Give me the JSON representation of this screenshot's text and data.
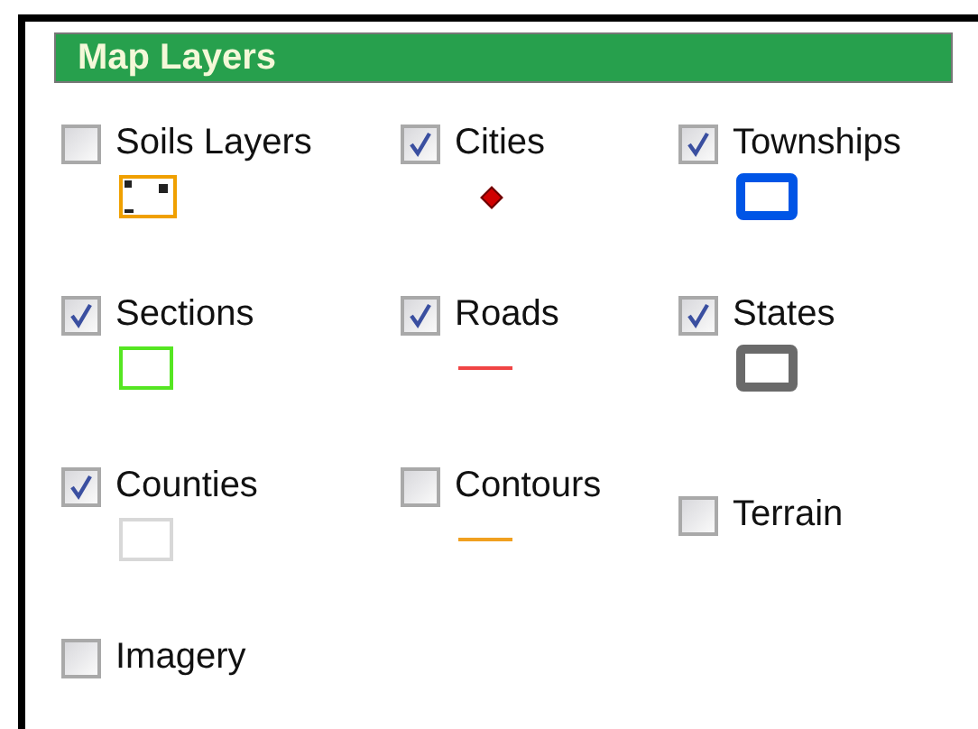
{
  "panel": {
    "title": "Map Layers"
  },
  "layers": [
    {
      "label": "Soils Layers",
      "checked": false,
      "legend": {
        "kind": "dashed-box",
        "color": "#f0a000"
      }
    },
    {
      "label": "Cities",
      "checked": true,
      "legend": {
        "kind": "dot",
        "color": "#d00000"
      }
    },
    {
      "label": "Townships",
      "checked": true,
      "legend": {
        "kind": "thick-box",
        "color": "#0055e6"
      }
    },
    {
      "label": "Sections",
      "checked": true,
      "legend": {
        "kind": "thin-box",
        "color": "#55e622"
      }
    },
    {
      "label": "Roads",
      "checked": true,
      "legend": {
        "kind": "line",
        "color": "#f04444"
      }
    },
    {
      "label": "States",
      "checked": true,
      "legend": {
        "kind": "thick-box",
        "color": "#6a6a6a"
      }
    },
    {
      "label": "Counties",
      "checked": true,
      "legend": {
        "kind": "thin-box",
        "color": "#d8d8d8"
      }
    },
    {
      "label": "Contours",
      "checked": false,
      "legend": {
        "kind": "line",
        "color": "#f0a020"
      }
    },
    {
      "label": "Terrain",
      "checked": false
    },
    {
      "label": "Imagery",
      "checked": false
    }
  ]
}
